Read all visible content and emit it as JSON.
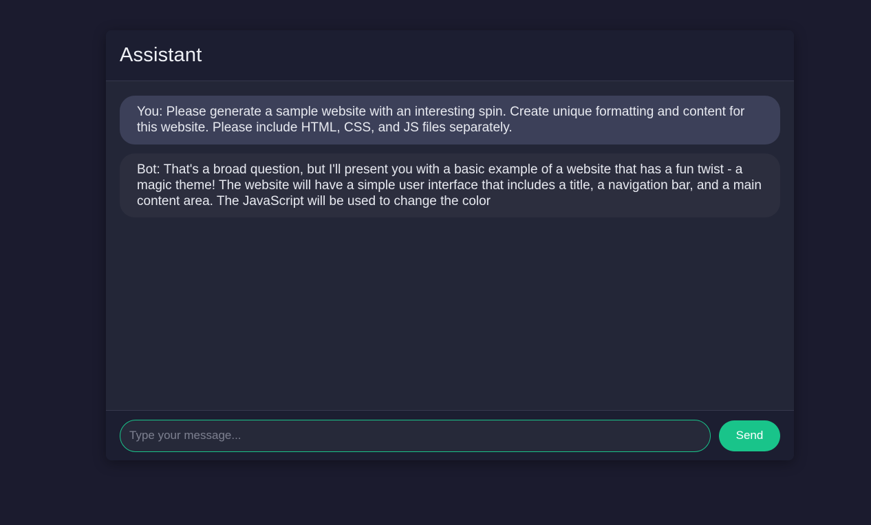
{
  "header": {
    "title": "Assistant"
  },
  "messages": [
    {
      "role": "user",
      "text": "You: Please generate a sample website with an interesting spin. Create unique formatting and content for this website. Please include HTML, CSS, and JS files separately."
    },
    {
      "role": "bot",
      "text": "Bot: That's a broad question, but I'll present you with a basic example of a website that has a fun twist - a magic theme! The website will have a simple user interface that includes a title, a navigation bar, and a main content area. The JavaScript will be used to change the color"
    }
  ],
  "composer": {
    "input_value": "",
    "placeholder": "Type your message...",
    "send_label": "Send"
  },
  "colors": {
    "page_background": "#1b1b2e",
    "accent": "#19c48a",
    "user_bubble": "#3c4059",
    "bot_bubble": "#2c2e3e"
  }
}
